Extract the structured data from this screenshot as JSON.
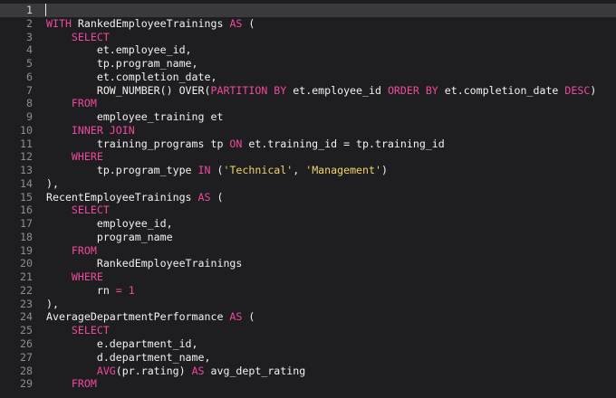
{
  "editor": {
    "active_line": 1,
    "colors": {
      "background": "#1e1e20",
      "active_line": "#3a3a3d",
      "keyword": "#ee4a9e",
      "string": "#f5d36a",
      "text": "#f2f2f2",
      "line_number": "#8e8e8e"
    },
    "lines": [
      {
        "n": "1",
        "tokens": []
      },
      {
        "n": "2",
        "tokens": [
          [
            "kw",
            "WITH"
          ],
          [
            "t",
            " RankedEmployeeTrainings "
          ],
          [
            "kw",
            "AS"
          ],
          [
            "t",
            " ("
          ]
        ]
      },
      {
        "n": "3",
        "tokens": [
          [
            "t",
            "    "
          ],
          [
            "kw",
            "SELECT"
          ]
        ]
      },
      {
        "n": "4",
        "tokens": [
          [
            "t",
            "        et.employee_id,"
          ]
        ]
      },
      {
        "n": "5",
        "tokens": [
          [
            "t",
            "        tp.program_name,"
          ]
        ]
      },
      {
        "n": "6",
        "tokens": [
          [
            "t",
            "        et.completion_date,"
          ]
        ]
      },
      {
        "n": "7",
        "tokens": [
          [
            "t",
            "        ROW_NUMBER() OVER("
          ],
          [
            "kw",
            "PARTITION BY"
          ],
          [
            "t",
            " et.employee_id "
          ],
          [
            "kw",
            "ORDER BY"
          ],
          [
            "t",
            " et.completion_date "
          ],
          [
            "kw",
            "DESC"
          ],
          [
            "t",
            ")"
          ]
        ]
      },
      {
        "n": "8",
        "tokens": [
          [
            "t",
            "    "
          ],
          [
            "kw",
            "FROM"
          ]
        ]
      },
      {
        "n": "9",
        "tokens": [
          [
            "t",
            "        employee_training et"
          ]
        ]
      },
      {
        "n": "10",
        "tokens": [
          [
            "t",
            "    "
          ],
          [
            "kw",
            "INNER JOIN"
          ]
        ]
      },
      {
        "n": "11",
        "tokens": [
          [
            "t",
            "        training_programs tp "
          ],
          [
            "kw",
            "ON"
          ],
          [
            "t",
            " et.training_id = tp.training_id"
          ]
        ]
      },
      {
        "n": "12",
        "tokens": [
          [
            "t",
            "    "
          ],
          [
            "kw",
            "WHERE"
          ]
        ]
      },
      {
        "n": "13",
        "tokens": [
          [
            "t",
            "        tp.program_type "
          ],
          [
            "kw",
            "IN"
          ],
          [
            "t",
            " ("
          ],
          [
            "str",
            "'Technical'"
          ],
          [
            "t",
            ", "
          ],
          [
            "str",
            "'Management'"
          ],
          [
            "t",
            ")"
          ]
        ]
      },
      {
        "n": "14",
        "tokens": [
          [
            "t",
            "),"
          ]
        ]
      },
      {
        "n": "15",
        "tokens": [
          [
            "t",
            "RecentEmployeeTrainings "
          ],
          [
            "kw",
            "AS"
          ],
          [
            "t",
            " ("
          ]
        ]
      },
      {
        "n": "16",
        "tokens": [
          [
            "t",
            "    "
          ],
          [
            "kw",
            "SELECT"
          ]
        ]
      },
      {
        "n": "17",
        "tokens": [
          [
            "t",
            "        employee_id,"
          ]
        ]
      },
      {
        "n": "18",
        "tokens": [
          [
            "t",
            "        program_name"
          ]
        ]
      },
      {
        "n": "19",
        "tokens": [
          [
            "t",
            "    "
          ],
          [
            "kw",
            "FROM"
          ]
        ]
      },
      {
        "n": "20",
        "tokens": [
          [
            "t",
            "        RankedEmployeeTrainings"
          ]
        ]
      },
      {
        "n": "21",
        "tokens": [
          [
            "t",
            "    "
          ],
          [
            "kw",
            "WHERE"
          ]
        ]
      },
      {
        "n": "22",
        "tokens": [
          [
            "t",
            "        rn "
          ],
          [
            "kw",
            "="
          ],
          [
            "t",
            " "
          ],
          [
            "num",
            "1"
          ]
        ]
      },
      {
        "n": "23",
        "tokens": [
          [
            "t",
            "),"
          ]
        ]
      },
      {
        "n": "24",
        "tokens": [
          [
            "t",
            "AverageDepartmentPerformance "
          ],
          [
            "kw",
            "AS"
          ],
          [
            "t",
            " ("
          ]
        ]
      },
      {
        "n": "25",
        "tokens": [
          [
            "t",
            "    "
          ],
          [
            "kw",
            "SELECT"
          ]
        ]
      },
      {
        "n": "26",
        "tokens": [
          [
            "t",
            "        e.department_id,"
          ]
        ]
      },
      {
        "n": "27",
        "tokens": [
          [
            "t",
            "        d.department_name,"
          ]
        ]
      },
      {
        "n": "28",
        "tokens": [
          [
            "t",
            "        "
          ],
          [
            "kw",
            "AVG"
          ],
          [
            "t",
            "(pr.rating) "
          ],
          [
            "kw",
            "AS"
          ],
          [
            "t",
            " avg_dept_rating"
          ]
        ]
      },
      {
        "n": "29",
        "tokens": [
          [
            "t",
            "    "
          ],
          [
            "kw",
            "FROM"
          ]
        ]
      }
    ]
  }
}
